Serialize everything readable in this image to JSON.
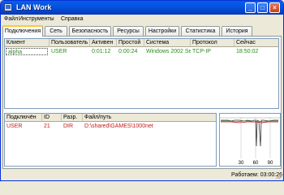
{
  "window": {
    "title": "LAN Work",
    "buttons": {
      "minimize": "_",
      "maximize": "□",
      "close": "×"
    }
  },
  "menu": [
    {
      "label": "Файл"
    },
    {
      "label": "Инструменты"
    },
    {
      "label": "Справка"
    }
  ],
  "tabs": [
    {
      "label": "Подключения"
    },
    {
      "label": "Сеть"
    },
    {
      "label": "Безопасность"
    },
    {
      "label": "Ресурсы"
    },
    {
      "label": "Настройки"
    },
    {
      "label": "Статистика"
    },
    {
      "label": "История"
    }
  ],
  "connections": {
    "columns": [
      "Клиент",
      "Пользователь",
      "Активен",
      "Простой",
      "Система",
      "Протокол",
      "Сейчас"
    ],
    "rows": [
      [
        "alpha",
        "USER",
        "0:01:12",
        "0:00:24",
        "Windows 2002 Se",
        "TCP-IP",
        "18:50:02"
      ]
    ]
  },
  "files": {
    "columns": [
      "Подключён",
      "ID",
      "Разр.",
      "Файл/путь"
    ],
    "rows": [
      [
        "USER",
        "21",
        "DIR",
        "D:\\shared\\GAMES\\1000net"
      ]
    ]
  },
  "graph": {
    "ticks": [
      "30",
      "60",
      "90"
    ]
  },
  "status": {
    "uptime_label": "Работаем: 03:00:26"
  },
  "colors": {
    "row_connection": "#2a8c1a",
    "row_file": "#c41a1a",
    "titlebar": "#0454e0"
  }
}
